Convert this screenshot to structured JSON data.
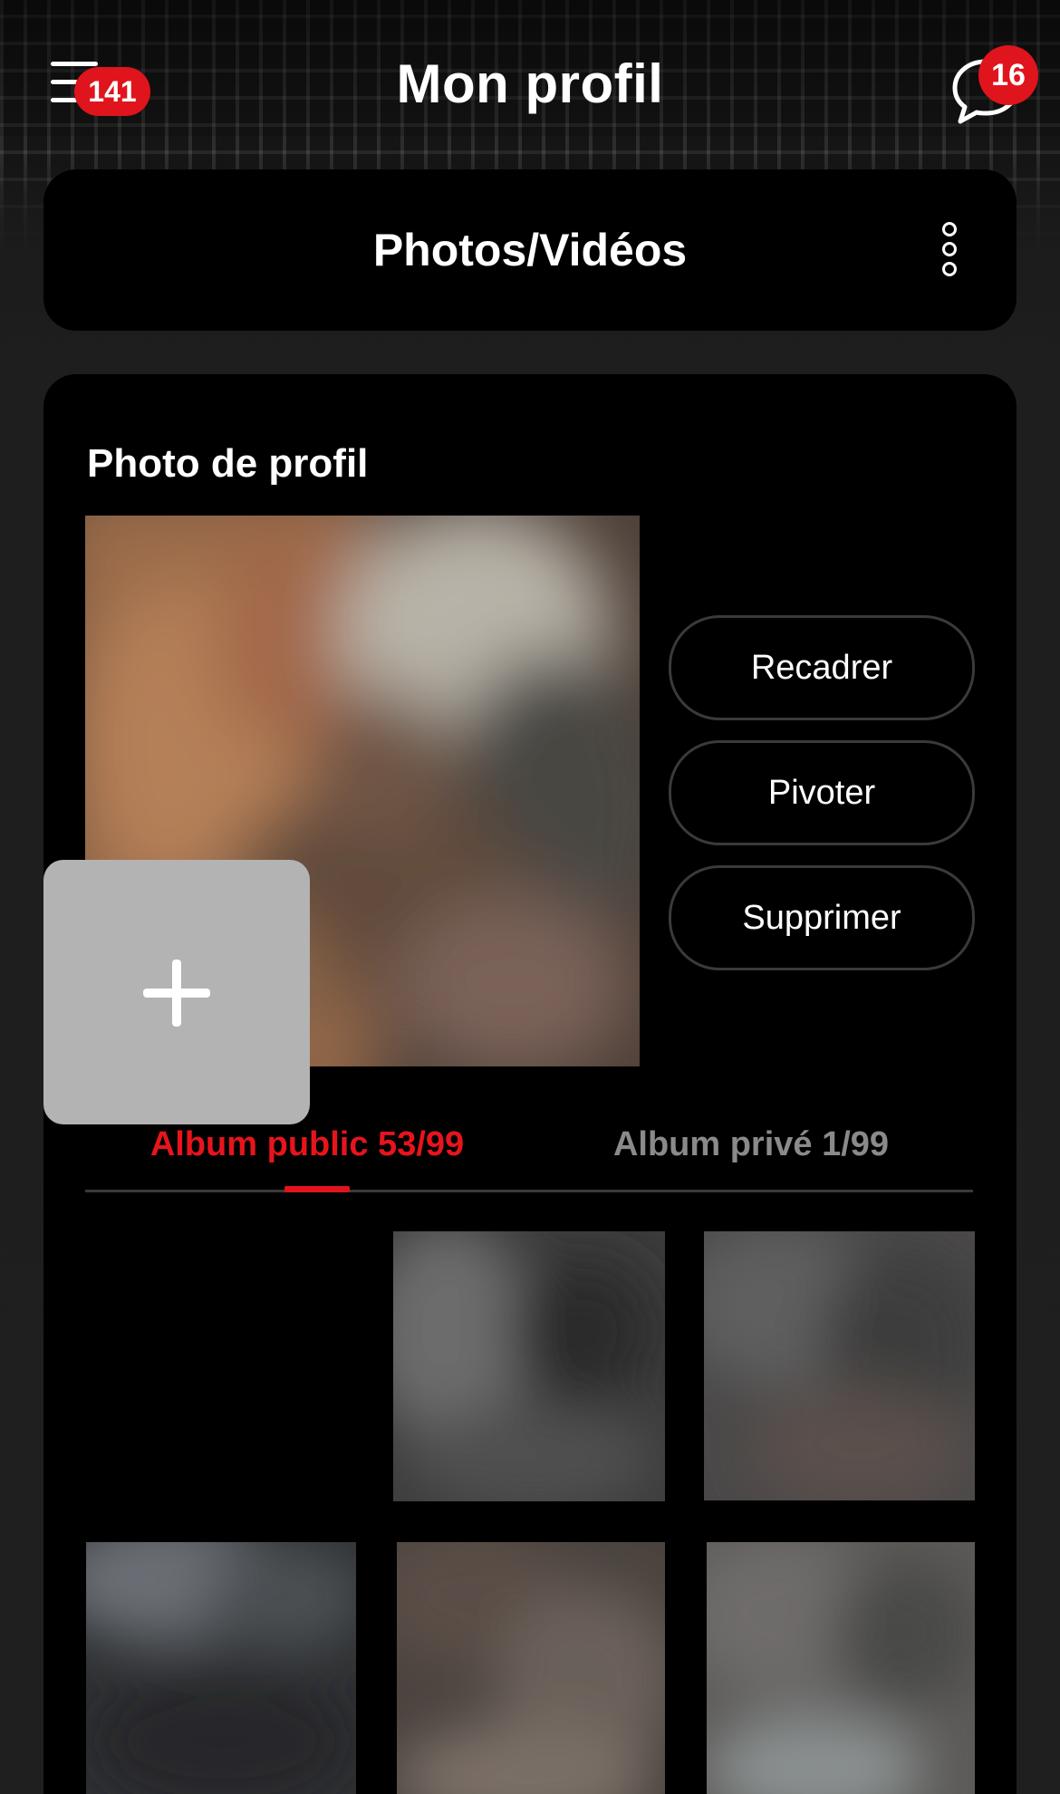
{
  "header": {
    "title": "Mon profil",
    "menu_badge": "141",
    "chat_badge": "16",
    "menu_icon": "hamburger-menu-icon",
    "chat_icon": "chat-bubble-icon"
  },
  "section": {
    "title": "Photos/Vidéos",
    "more_icon": "vertical-ellipsis-icon"
  },
  "profile_photo": {
    "label": "Photo de profil",
    "actions": [
      "Recadrer",
      "Pivoter",
      "Supprimer"
    ]
  },
  "tabs": [
    {
      "label": "Album public 53/99",
      "active": true
    },
    {
      "label": "Album privé 1/99",
      "active": false
    }
  ],
  "grid": {
    "add_icon": "plus-icon",
    "items": [
      "photo",
      "photo",
      "photo",
      "photo",
      "photo",
      "photo"
    ]
  },
  "colors": {
    "accent": "#e0141c",
    "background": "#1c1c1c",
    "card": "#000000",
    "inactive_tab": "#8a8a8a",
    "add_tile": "#b3b3b3"
  }
}
